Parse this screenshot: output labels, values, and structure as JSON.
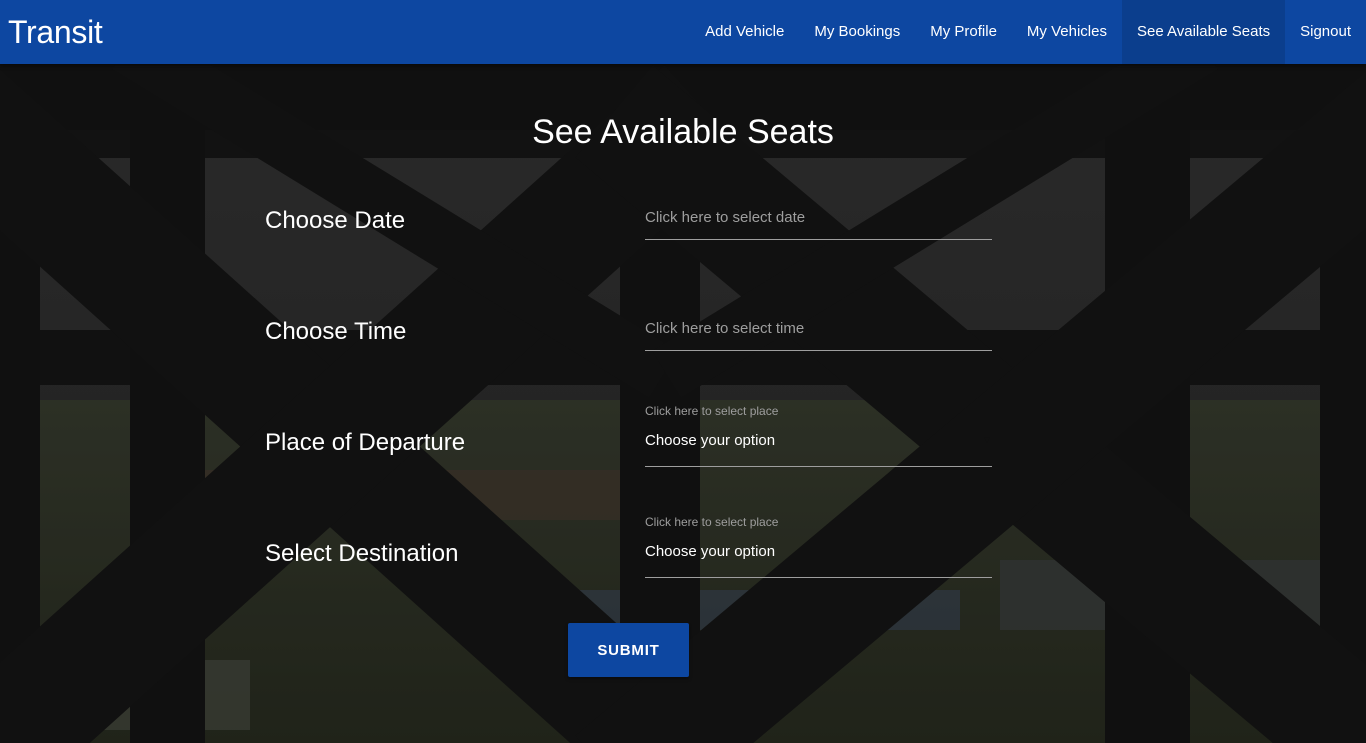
{
  "app": {
    "brand": "Transit",
    "accent_color": "#0d47a1"
  },
  "nav": {
    "items": [
      {
        "label": "Add Vehicle",
        "active": false
      },
      {
        "label": "My Bookings",
        "active": false
      },
      {
        "label": "My Profile",
        "active": false
      },
      {
        "label": "My Vehicles",
        "active": false
      },
      {
        "label": "See Available Seats",
        "active": true
      },
      {
        "label": "Signout",
        "active": false
      }
    ]
  },
  "form": {
    "title": "See Available Seats",
    "date": {
      "label": "Choose Date",
      "placeholder": "Click here to select date",
      "value": ""
    },
    "time": {
      "label": "Choose Time",
      "placeholder": "Click here to select time",
      "value": ""
    },
    "departure": {
      "label": "Place of Departure",
      "hint": "Click here to select place",
      "selected": "Choose your option"
    },
    "destination": {
      "label": "Select Destination",
      "hint": "Click here to select place",
      "selected": "Choose your option"
    },
    "submit_label": "SUBMIT"
  }
}
